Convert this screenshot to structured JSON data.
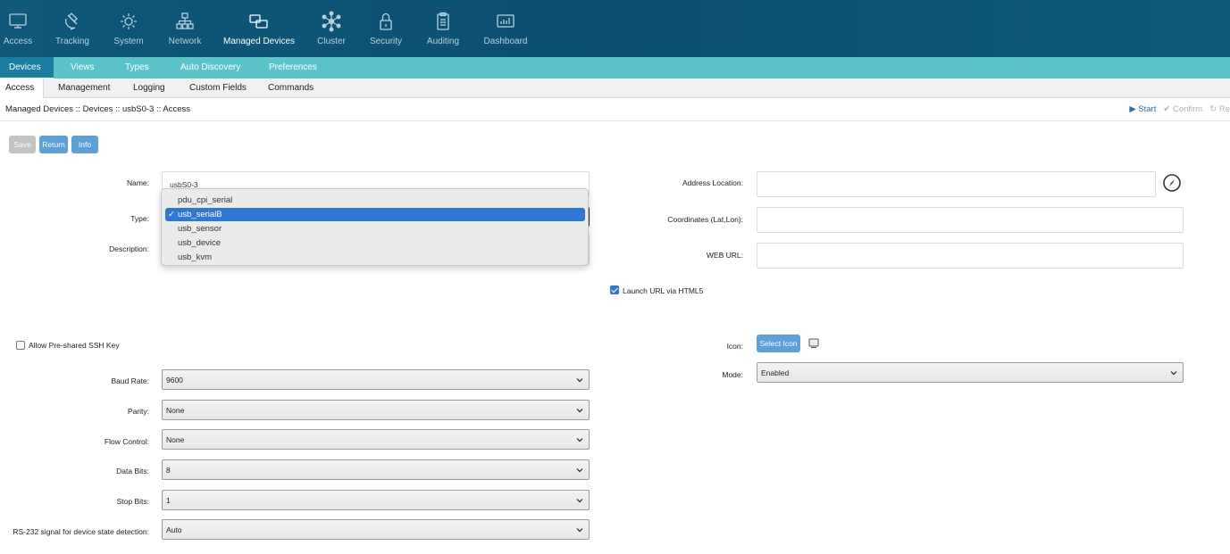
{
  "topnav": {
    "items": [
      {
        "label": "Access",
        "icon": "monitor-icon"
      },
      {
        "label": "Tracking",
        "icon": "satellite-icon"
      },
      {
        "label": "System",
        "icon": "gear-icon"
      },
      {
        "label": "Network",
        "icon": "network-icon"
      },
      {
        "label": "Managed Devices",
        "icon": "devices-icon"
      },
      {
        "label": "Cluster",
        "icon": "cluster-icon"
      },
      {
        "label": "Security",
        "icon": "lock-icon"
      },
      {
        "label": "Auditing",
        "icon": "clipboard-icon"
      },
      {
        "label": "Dashboard",
        "icon": "dashboard-icon"
      }
    ],
    "active": "Managed Devices"
  },
  "subnav": {
    "tabs": [
      "Devices",
      "Views",
      "Types",
      "Auto Discovery",
      "Preferences"
    ],
    "active": "Devices"
  },
  "thirdnav": {
    "tabs": [
      "Access",
      "Management",
      "Logging",
      "Custom Fields",
      "Commands"
    ],
    "active": "Access"
  },
  "breadcrumb": "Managed Devices :: Devices :: usbS0-3 :: Access",
  "actions": {
    "start": "Start",
    "confirm": "Confirm",
    "re": "Re"
  },
  "buttons": {
    "save": "Save",
    "return": "Return",
    "info": "Info"
  },
  "form": {
    "name_label": "Name:",
    "name_value": "usbS0-3",
    "type_label": "Type:",
    "description_label": "Description:",
    "type_options": [
      "pdu_cpi_serial",
      "usb_serialB",
      "usb_sensor",
      "usb_device",
      "usb_kvm"
    ],
    "type_selected": "usb_serialB",
    "address_label": "Address Location:",
    "coordinates_label": "Coordinates (Lat,Lon):",
    "weburl_label": "WEB URL:",
    "launch_html5_label": "Launch URL via HTML5",
    "launch_html5_checked": true,
    "allow_ssh_label": "Allow Pre-shared SSH Key",
    "allow_ssh_checked": false,
    "icon_label": "Icon:",
    "select_icon_button": "Select Icon",
    "mode_label": "Mode:",
    "mode_value": "Enabled",
    "baud_label": "Baud Rate:",
    "baud_value": "9600",
    "parity_label": "Parity:",
    "parity_value": "None",
    "flow_label": "Flow Control:",
    "flow_value": "None",
    "databits_label": "Data Bits:",
    "databits_value": "8",
    "stopbits_label": "Stop Bits:",
    "stopbits_value": "1",
    "rs232_label": "RS-232 signal for device state detection:",
    "rs232_value": "Auto"
  },
  "colors": {
    "nav_bg": "#0c4f70",
    "teal": "#5ac4c9",
    "accent": "#2f76d6",
    "button_blue": "#5d9fd9"
  }
}
